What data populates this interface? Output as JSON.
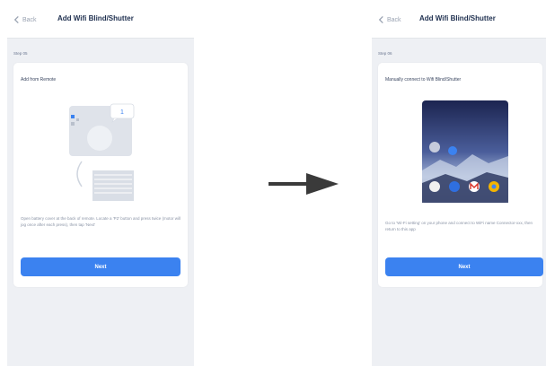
{
  "screens": [
    {
      "back_label": "Back",
      "title": "Add Wifi Blind/Shutter",
      "step": "Step 05",
      "card_title": "Add from Remote",
      "illustration_badge": "1",
      "instructions": "Open battery cover at the back of remote. Locate a 'P2' button and press twice (motor will jog once after each press), then tap 'Next'",
      "next_label": "Next"
    },
    {
      "back_label": "Back",
      "title": "Add Wifi Blind/Shutter",
      "step": "Step 06",
      "card_title": "Manually connect to Wifi Blind/Shutter",
      "instructions": "Go to 'Wi-Fi setting' on your phone and connect to WiFi name Connector-xxx, then return to this app",
      "next_label": "Next"
    }
  ],
  "colors": {
    "accent": "#3b82f0",
    "title": "#1e2f4f",
    "background": "#eef0f4"
  },
  "icons": [
    "chevron-left-icon",
    "transition-arrow-icon",
    "remote-illustration",
    "phone-home-screen-illustration"
  ]
}
